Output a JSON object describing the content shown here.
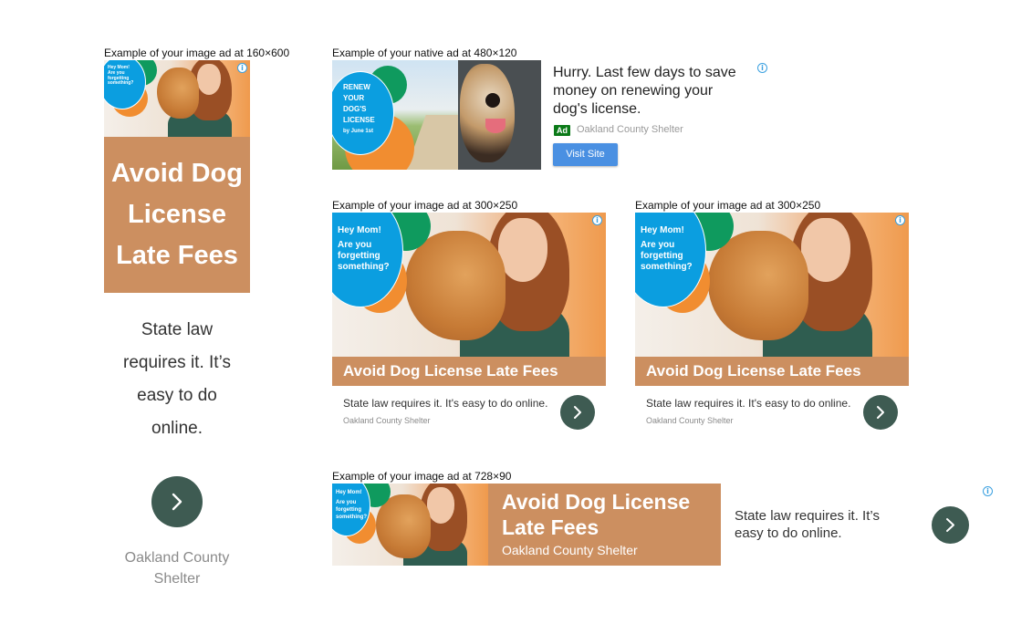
{
  "captions": {
    "ad160": "Example of your image ad at 160×600",
    "native": "Example of your native ad at 480×120",
    "ad300a": "Example of your image ad at 300×250",
    "ad300b": "Example of your image ad at 300×250",
    "ad728": "Example of your image ad at 728×90"
  },
  "info_icon": "i",
  "creative": {
    "blue_circle_line1": "Hey Mom!",
    "blue_circle_line2": "Are you forgetting something?",
    "headline": "Avoid Dog License Late Fees",
    "description": "State law requires it. It's easy to do online.",
    "advertiser": "Oakland County Shelter"
  },
  "skyscraper": {
    "headline": "Avoid Dog License Late Fees",
    "description": "State law requires it. It’s easy to do online.",
    "advertiser": "Oakland County Shelter"
  },
  "native": {
    "circle_line1": "RENEW YOUR DOG'S LICENSE",
    "circle_line2": "by June 1st",
    "headline": "Hurry. Last few days to save money on renewing your dog's license.",
    "ad_badge": "Ad",
    "advertiser": "Oakland County Shelter",
    "cta": "Visit Site"
  },
  "leaderboard": {
    "headline": "Avoid Dog License Late Fees",
    "advertiser": "Oakland County Shelter",
    "description": "State law requires it. It’s easy to do online."
  },
  "colors": {
    "tan": "#cc8f60",
    "arrow_button": "#3e5b52",
    "cta_blue": "#4a90e2",
    "ad_badge_green": "#0b7a18"
  },
  "icons": {
    "info": "info-icon",
    "next": "chevron-right-icon"
  }
}
